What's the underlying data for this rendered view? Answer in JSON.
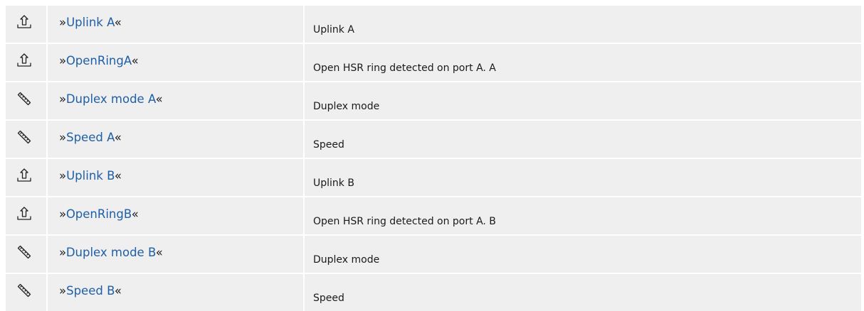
{
  "rows": [
    {
      "icon": "upload-icon",
      "name": "Uplink A",
      "description": "Uplink A"
    },
    {
      "icon": "upload-icon",
      "name": "OpenRingA",
      "description": "Open HSR ring detected on port A. A"
    },
    {
      "icon": "ruler-icon",
      "name": "Duplex mode A",
      "description": "Duplex mode"
    },
    {
      "icon": "ruler-icon",
      "name": "Speed A",
      "description": "Speed"
    },
    {
      "icon": "upload-icon",
      "name": "Uplink B",
      "description": "Uplink B"
    },
    {
      "icon": "upload-icon",
      "name": "OpenRingB",
      "description": "Open HSR ring detected on port A. B"
    },
    {
      "icon": "ruler-icon",
      "name": "Duplex mode B",
      "description": "Duplex mode"
    },
    {
      "icon": "ruler-icon",
      "name": "Speed B",
      "description": "Speed"
    }
  ],
  "quote_open": "»",
  "quote_close": "«",
  "colors": {
    "cell_background": "#efefef",
    "link": "#1f5fa6"
  }
}
